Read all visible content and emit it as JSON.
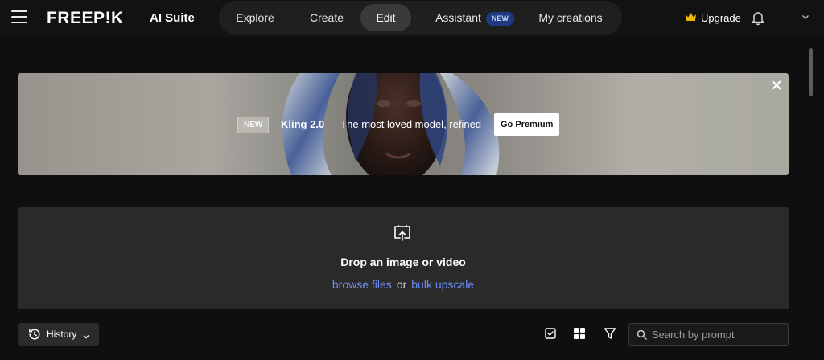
{
  "header": {
    "logo_text": "FREEP!K",
    "suite_label": "AI Suite",
    "nav": [
      {
        "label": "Explore"
      },
      {
        "label": "Create"
      },
      {
        "label": "Edit",
        "active": true
      },
      {
        "label": "Assistant",
        "badge": "NEW"
      },
      {
        "label": "My creations"
      }
    ],
    "upgrade_label": "Upgrade",
    "icons": [
      "menu-icon",
      "crown-icon",
      "bell-icon",
      "chevron-down-icon"
    ]
  },
  "banner": {
    "tag": "NEW",
    "title_bold": "Kling 2.0",
    "title_rest": " — The most loved model, refined",
    "cta": "Go Premium"
  },
  "dropzone": {
    "title": "Drop an image or video",
    "browse_link": "browse files",
    "or_text": "or",
    "bulk_link": "bulk upscale"
  },
  "toolbar": {
    "history_label": "History",
    "search_placeholder": "Search by prompt",
    "tools": [
      "select-icon",
      "grid-icon",
      "filter-icon"
    ]
  },
  "colors": {
    "background": "#0f0f0f",
    "panel": "#2a2a2a",
    "link": "#6c8cf5",
    "new_badge": "#1f3a80",
    "crown": "#f2b705"
  }
}
